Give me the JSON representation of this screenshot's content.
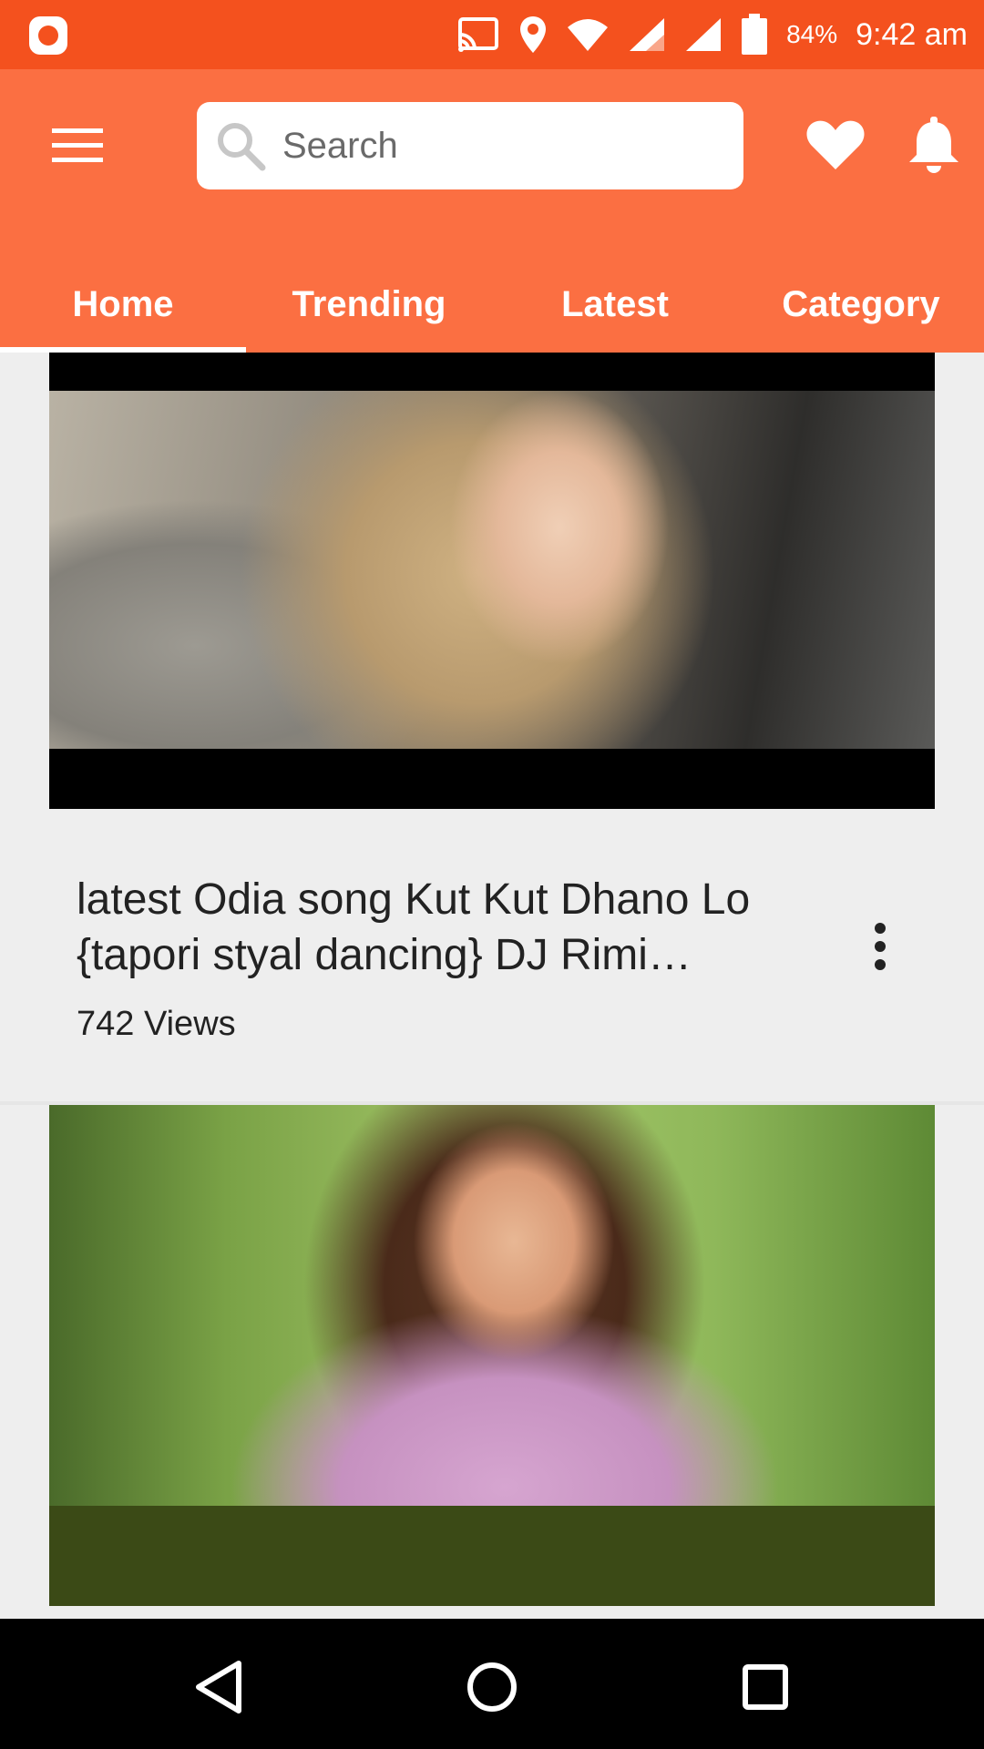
{
  "status_bar": {
    "battery": "84%",
    "time": "9:42 am",
    "icons": [
      "app-notification-icon",
      "cast-icon",
      "location-icon",
      "wifi-icon",
      "signal-icon",
      "signal-icon",
      "battery-icon"
    ]
  },
  "app_bar": {
    "search_placeholder": "Search",
    "icons": [
      "menu-icon",
      "search-icon",
      "heart-icon",
      "bell-icon"
    ],
    "colors": {
      "status": "#f4511e",
      "toolbar": "#fb6f42"
    }
  },
  "tabs": [
    {
      "label": "Home",
      "active": true
    },
    {
      "label": "Trending",
      "active": false
    },
    {
      "label": "Latest",
      "active": false
    },
    {
      "label": "Category",
      "active": false
    }
  ],
  "videos": [
    {
      "title": "latest Odia song Kut Kut Dhano Lo {tapori styal dancing} DJ Rimi…",
      "views": "742 Views"
    },
    {
      "title": "",
      "views": ""
    }
  ],
  "nav_bar": {
    "icons": [
      "back-icon",
      "home-icon",
      "recent-apps-icon"
    ]
  }
}
